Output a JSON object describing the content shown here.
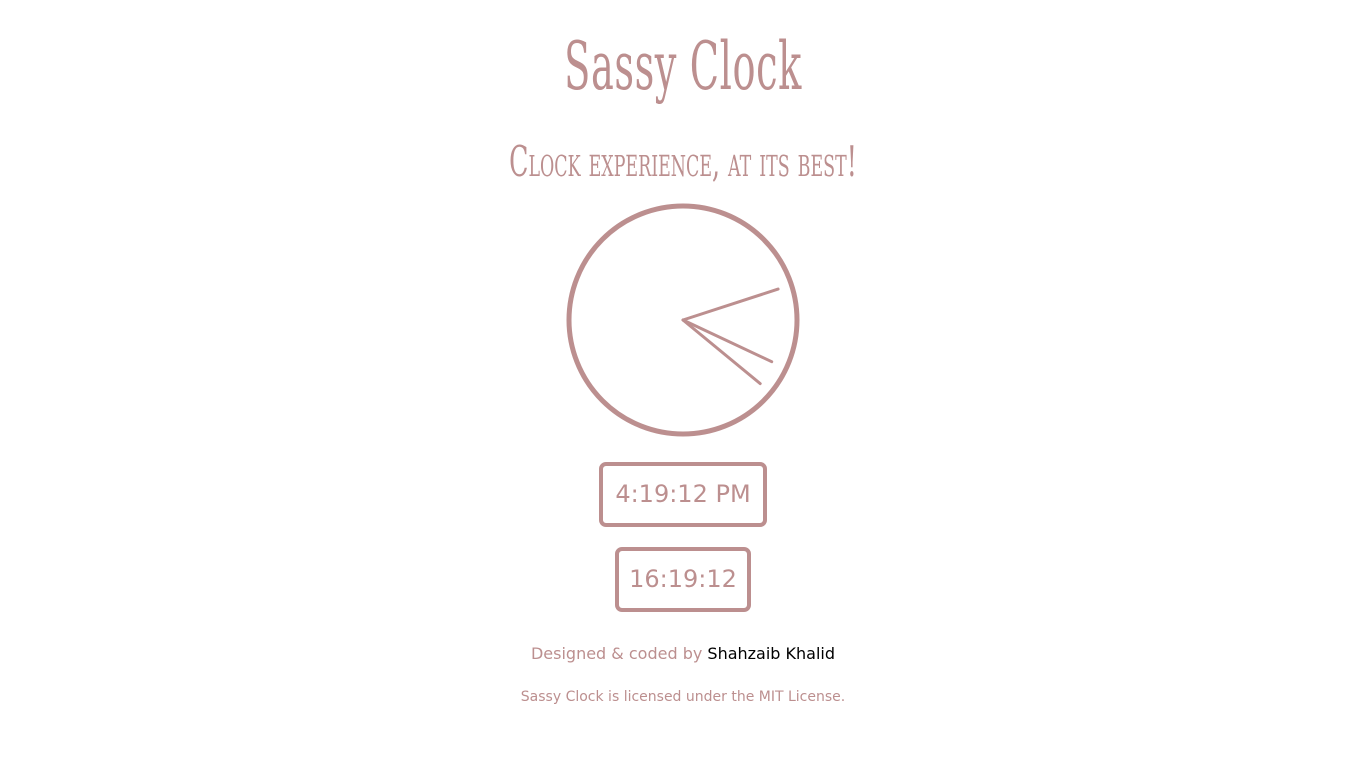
{
  "header": {
    "title": "Sassy Clock",
    "subtitle": "Clock experience, at its best!"
  },
  "clock": {
    "hours": 4,
    "minutes": 19,
    "seconds": 12
  },
  "digital": {
    "time_12h": "4:19:12 PM",
    "time_24h": "16:19:12"
  },
  "footer": {
    "credit_prefix": "Designed & coded by",
    "author_name": "Shahzaib Khalid",
    "license_text": "Sassy Clock is licensed under the MIT License."
  },
  "colors": {
    "accent": "#bc8f8f",
    "link": "#000000",
    "background": "#ffffff"
  }
}
